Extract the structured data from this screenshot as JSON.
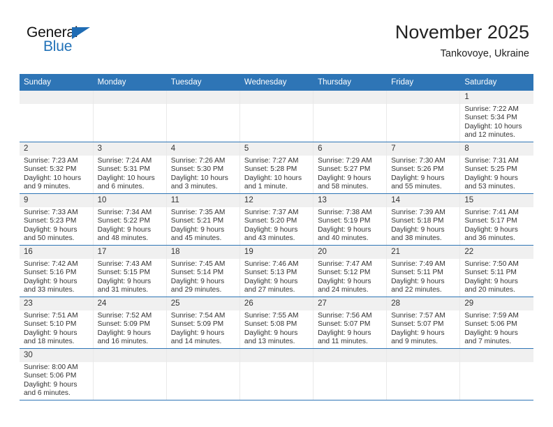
{
  "logo": {
    "word_one": "General",
    "word_two": "Blue",
    "triangle_icon": "triangle-right-icon",
    "brand_color": "#2272b8"
  },
  "header": {
    "title": "November 2025",
    "subtitle": "Tankovoye, Ukraine",
    "header_bg_color": "#2e75b6",
    "daynum_bg_color": "#f0f0f0"
  },
  "weekday_headers": [
    "Sunday",
    "Monday",
    "Tuesday",
    "Wednesday",
    "Thursday",
    "Friday",
    "Saturday"
  ],
  "weeks": [
    [
      {
        "day": "",
        "lines": []
      },
      {
        "day": "",
        "lines": []
      },
      {
        "day": "",
        "lines": []
      },
      {
        "day": "",
        "lines": []
      },
      {
        "day": "",
        "lines": []
      },
      {
        "day": "",
        "lines": []
      },
      {
        "day": "1",
        "lines": [
          "Sunrise: 7:22 AM",
          "Sunset: 5:34 PM",
          "Daylight: 10 hours",
          "and 12 minutes."
        ]
      }
    ],
    [
      {
        "day": "2",
        "lines": [
          "Sunrise: 7:23 AM",
          "Sunset: 5:32 PM",
          "Daylight: 10 hours",
          "and 9 minutes."
        ]
      },
      {
        "day": "3",
        "lines": [
          "Sunrise: 7:24 AM",
          "Sunset: 5:31 PM",
          "Daylight: 10 hours",
          "and 6 minutes."
        ]
      },
      {
        "day": "4",
        "lines": [
          "Sunrise: 7:26 AM",
          "Sunset: 5:30 PM",
          "Daylight: 10 hours",
          "and 3 minutes."
        ]
      },
      {
        "day": "5",
        "lines": [
          "Sunrise: 7:27 AM",
          "Sunset: 5:28 PM",
          "Daylight: 10 hours",
          "and 1 minute."
        ]
      },
      {
        "day": "6",
        "lines": [
          "Sunrise: 7:29 AM",
          "Sunset: 5:27 PM",
          "Daylight: 9 hours",
          "and 58 minutes."
        ]
      },
      {
        "day": "7",
        "lines": [
          "Sunrise: 7:30 AM",
          "Sunset: 5:26 PM",
          "Daylight: 9 hours",
          "and 55 minutes."
        ]
      },
      {
        "day": "8",
        "lines": [
          "Sunrise: 7:31 AM",
          "Sunset: 5:25 PM",
          "Daylight: 9 hours",
          "and 53 minutes."
        ]
      }
    ],
    [
      {
        "day": "9",
        "lines": [
          "Sunrise: 7:33 AM",
          "Sunset: 5:23 PM",
          "Daylight: 9 hours",
          "and 50 minutes."
        ]
      },
      {
        "day": "10",
        "lines": [
          "Sunrise: 7:34 AM",
          "Sunset: 5:22 PM",
          "Daylight: 9 hours",
          "and 48 minutes."
        ]
      },
      {
        "day": "11",
        "lines": [
          "Sunrise: 7:35 AM",
          "Sunset: 5:21 PM",
          "Daylight: 9 hours",
          "and 45 minutes."
        ]
      },
      {
        "day": "12",
        "lines": [
          "Sunrise: 7:37 AM",
          "Sunset: 5:20 PM",
          "Daylight: 9 hours",
          "and 43 minutes."
        ]
      },
      {
        "day": "13",
        "lines": [
          "Sunrise: 7:38 AM",
          "Sunset: 5:19 PM",
          "Daylight: 9 hours",
          "and 40 minutes."
        ]
      },
      {
        "day": "14",
        "lines": [
          "Sunrise: 7:39 AM",
          "Sunset: 5:18 PM",
          "Daylight: 9 hours",
          "and 38 minutes."
        ]
      },
      {
        "day": "15",
        "lines": [
          "Sunrise: 7:41 AM",
          "Sunset: 5:17 PM",
          "Daylight: 9 hours",
          "and 36 minutes."
        ]
      }
    ],
    [
      {
        "day": "16",
        "lines": [
          "Sunrise: 7:42 AM",
          "Sunset: 5:16 PM",
          "Daylight: 9 hours",
          "and 33 minutes."
        ]
      },
      {
        "day": "17",
        "lines": [
          "Sunrise: 7:43 AM",
          "Sunset: 5:15 PM",
          "Daylight: 9 hours",
          "and 31 minutes."
        ]
      },
      {
        "day": "18",
        "lines": [
          "Sunrise: 7:45 AM",
          "Sunset: 5:14 PM",
          "Daylight: 9 hours",
          "and 29 minutes."
        ]
      },
      {
        "day": "19",
        "lines": [
          "Sunrise: 7:46 AM",
          "Sunset: 5:13 PM",
          "Daylight: 9 hours",
          "and 27 minutes."
        ]
      },
      {
        "day": "20",
        "lines": [
          "Sunrise: 7:47 AM",
          "Sunset: 5:12 PM",
          "Daylight: 9 hours",
          "and 24 minutes."
        ]
      },
      {
        "day": "21",
        "lines": [
          "Sunrise: 7:49 AM",
          "Sunset: 5:11 PM",
          "Daylight: 9 hours",
          "and 22 minutes."
        ]
      },
      {
        "day": "22",
        "lines": [
          "Sunrise: 7:50 AM",
          "Sunset: 5:11 PM",
          "Daylight: 9 hours",
          "and 20 minutes."
        ]
      }
    ],
    [
      {
        "day": "23",
        "lines": [
          "Sunrise: 7:51 AM",
          "Sunset: 5:10 PM",
          "Daylight: 9 hours",
          "and 18 minutes."
        ]
      },
      {
        "day": "24",
        "lines": [
          "Sunrise: 7:52 AM",
          "Sunset: 5:09 PM",
          "Daylight: 9 hours",
          "and 16 minutes."
        ]
      },
      {
        "day": "25",
        "lines": [
          "Sunrise: 7:54 AM",
          "Sunset: 5:09 PM",
          "Daylight: 9 hours",
          "and 14 minutes."
        ]
      },
      {
        "day": "26",
        "lines": [
          "Sunrise: 7:55 AM",
          "Sunset: 5:08 PM",
          "Daylight: 9 hours",
          "and 13 minutes."
        ]
      },
      {
        "day": "27",
        "lines": [
          "Sunrise: 7:56 AM",
          "Sunset: 5:07 PM",
          "Daylight: 9 hours",
          "and 11 minutes."
        ]
      },
      {
        "day": "28",
        "lines": [
          "Sunrise: 7:57 AM",
          "Sunset: 5:07 PM",
          "Daylight: 9 hours",
          "and 9 minutes."
        ]
      },
      {
        "day": "29",
        "lines": [
          "Sunrise: 7:59 AM",
          "Sunset: 5:06 PM",
          "Daylight: 9 hours",
          "and 7 minutes."
        ]
      }
    ],
    [
      {
        "day": "30",
        "lines": [
          "Sunrise: 8:00 AM",
          "Sunset: 5:06 PM",
          "Daylight: 9 hours",
          "and 6 minutes."
        ]
      },
      {
        "day": "",
        "lines": []
      },
      {
        "day": "",
        "lines": []
      },
      {
        "day": "",
        "lines": []
      },
      {
        "day": "",
        "lines": []
      },
      {
        "day": "",
        "lines": []
      },
      {
        "day": "",
        "lines": []
      }
    ]
  ]
}
